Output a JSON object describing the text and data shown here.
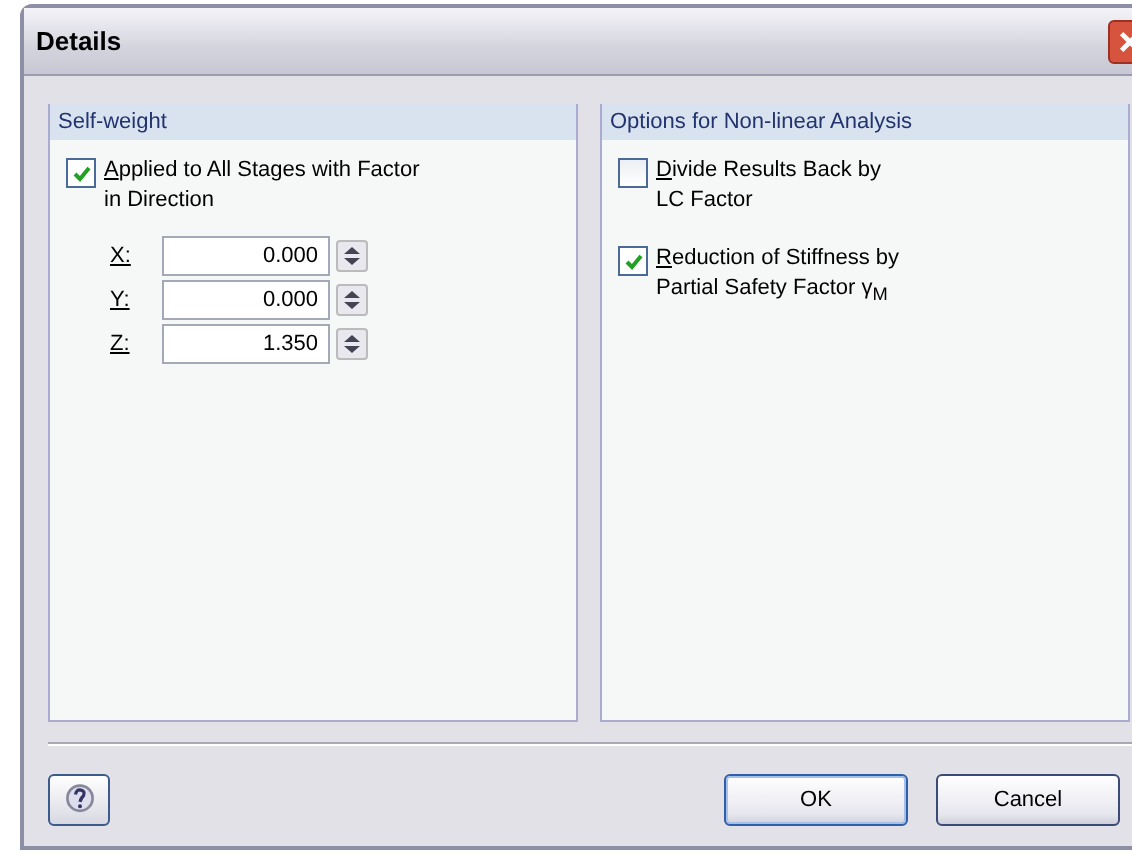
{
  "window": {
    "title": "Details"
  },
  "self_weight": {
    "title": "Self-weight",
    "option": {
      "lines": [
        "Applied to All Stages with Factor",
        "in Direction"
      ],
      "checked": true
    },
    "factors": [
      {
        "label": "X:",
        "value": "0.000"
      },
      {
        "label": "Y:",
        "value": "0.000"
      },
      {
        "label": "Z:",
        "value": "1.350"
      }
    ]
  },
  "nonlinear": {
    "title": "Options for Non-linear Analysis",
    "options": [
      {
        "lines": [
          "Divide Results Back by",
          "LC Factor"
        ],
        "checked": false
      },
      {
        "lines": [
          "Reduction of Stiffness by",
          "Partial Safety Factor γ$_{M}$"
        ],
        "checked": true
      }
    ]
  },
  "buttons": [
    "OK",
    "Cancel"
  ]
}
